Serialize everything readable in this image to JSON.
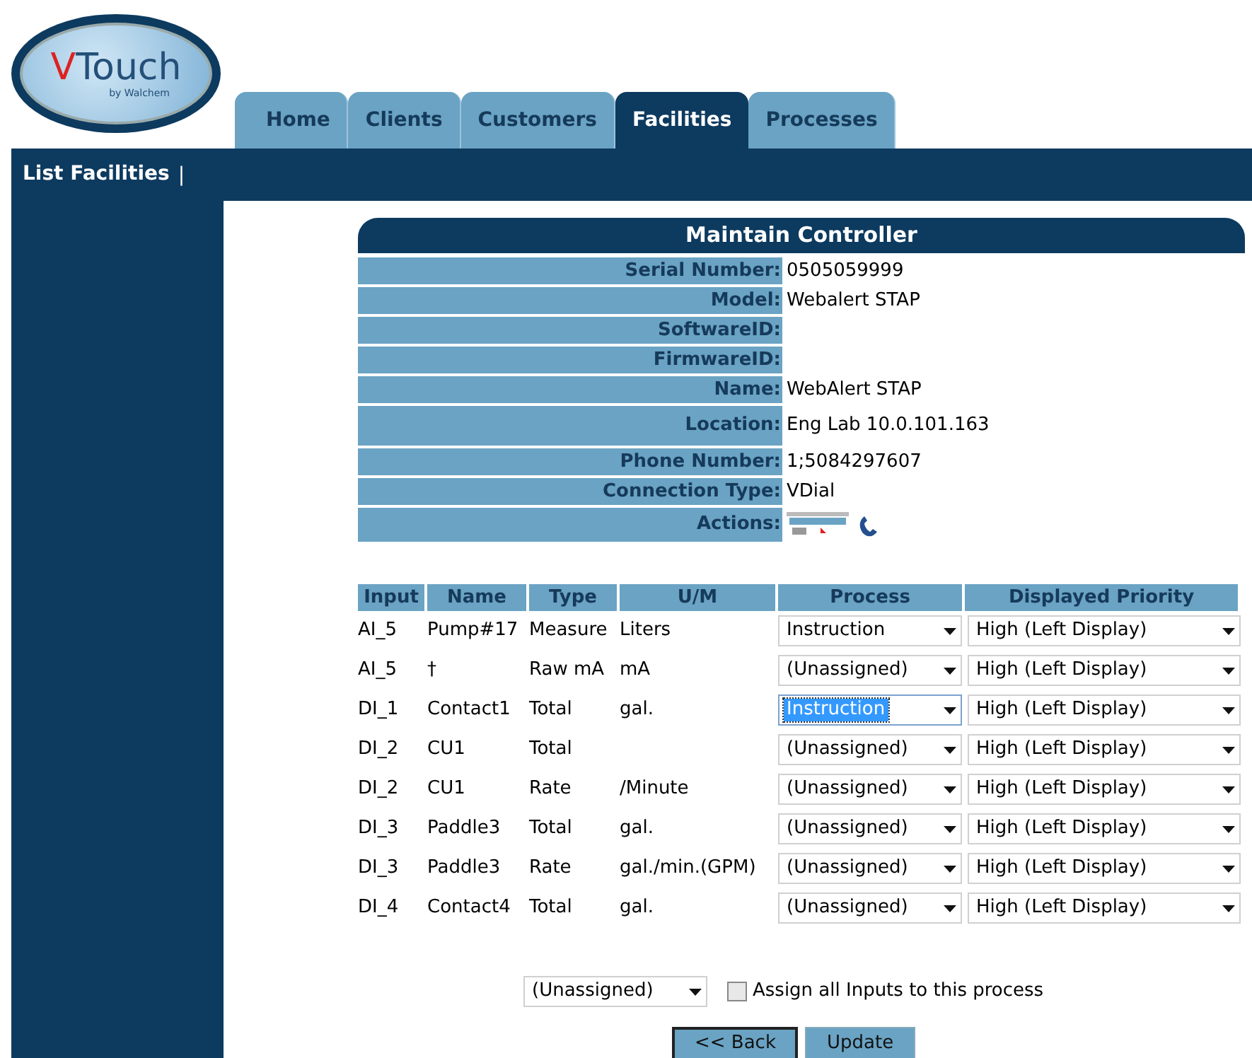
{
  "logo": {
    "text": "VTouch",
    "tagline": "by Walchem"
  },
  "tabs": [
    {
      "label": "Home",
      "selected": false
    },
    {
      "label": "Clients",
      "selected": false
    },
    {
      "label": "Customers",
      "selected": false
    },
    {
      "label": "Facilities",
      "selected": true
    },
    {
      "label": "Processes",
      "selected": false
    }
  ],
  "subnav": {
    "items": [
      "List Facilities"
    ],
    "separator": "|"
  },
  "panel": {
    "title": "Maintain Controller",
    "fields": [
      {
        "kind": "text",
        "label": "Serial Number:",
        "value": "0505059999"
      },
      {
        "kind": "text",
        "label": "Model:",
        "value": "Webalert STAP"
      },
      {
        "kind": "text",
        "label": "SoftwareID:"
      },
      {
        "kind": "text",
        "label": "FirmwareID:"
      },
      {
        "kind": "text",
        "label": "Name:",
        "value": "WebAlert STAP"
      },
      {
        "kind": "tall",
        "label": "Location:",
        "value": "Eng Lab 10.0.101.163"
      },
      {
        "kind": "text",
        "label": "Phone Number:",
        "value": "1;5084297607"
      },
      {
        "kind": "text",
        "label": "Connection Type:",
        "value": "VDial"
      },
      {
        "kind": "actions",
        "label": "Actions:"
      }
    ]
  },
  "table": {
    "columns": [
      "Input",
      "Name",
      "Type",
      "U/M",
      "Process",
      "Displayed Priority"
    ],
    "rows": [
      {
        "input": "AI_5",
        "name": "Pump#17",
        "type": "Measure",
        "um": "Liters",
        "process": "Instruction",
        "process_focused": false,
        "priority": "High (Left Display)"
      },
      {
        "input": "AI_5",
        "name": "†",
        "type": "Raw mA",
        "um": "mA",
        "process": "(Unassigned)",
        "process_focused": false,
        "priority": "High (Left Display)"
      },
      {
        "input": "DI_1",
        "name": "Contact1",
        "type": "Total",
        "um": "gal.",
        "process": "Instruction",
        "process_focused": true,
        "priority": "High (Left Display)"
      },
      {
        "input": "DI_2",
        "name": "CU1",
        "type": "Total",
        "process": "(Unassigned)",
        "process_focused": false,
        "priority": "High (Left Display)"
      },
      {
        "input": "DI_2",
        "name": "CU1",
        "type": "Rate",
        "um": "/Minute",
        "process": "(Unassigned)",
        "process_focused": false,
        "priority": "High (Left Display)"
      },
      {
        "input": "DI_3",
        "name": "Paddle3",
        "type": "Total",
        "um": "gal.",
        "process": "(Unassigned)",
        "process_focused": false,
        "priority": "High (Left Display)"
      },
      {
        "input": "DI_3",
        "name": "Paddle3",
        "type": "Rate",
        "um": "gal./min.(GPM)",
        "process": "(Unassigned)",
        "process_focused": false,
        "priority": "High (Left Display)"
      },
      {
        "input": "DI_4",
        "name": "Contact4",
        "type": "Total",
        "um": "gal.",
        "process": "(Unassigned)",
        "process_focused": false,
        "priority": "High (Left Display)"
      }
    ]
  },
  "assign": {
    "process": "(Unassigned)",
    "label": "Assign all Inputs to this process",
    "checked": false
  },
  "buttons": [
    {
      "label": "<< Back",
      "focused": true
    },
    {
      "label": "Update",
      "focused": false
    }
  ]
}
